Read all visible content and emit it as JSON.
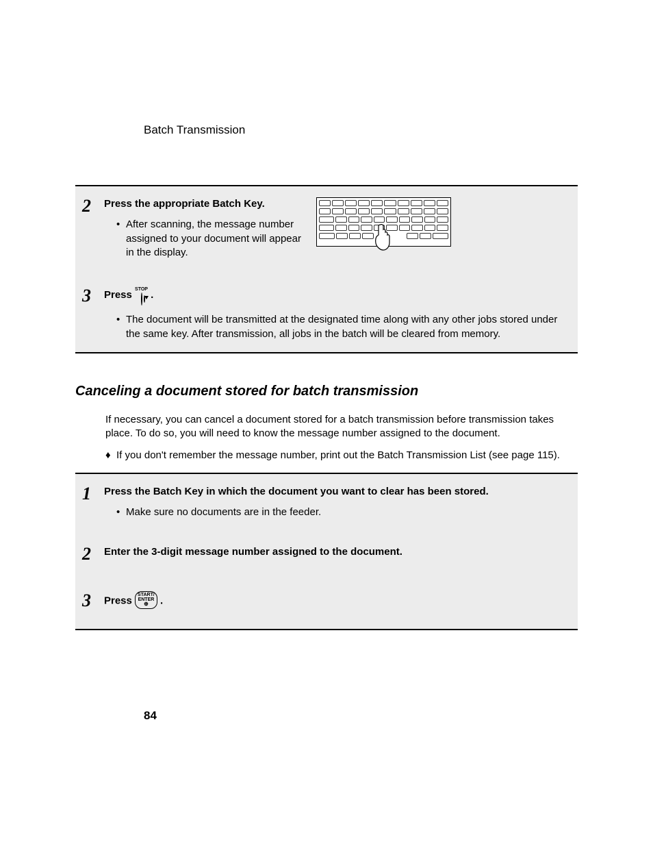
{
  "header": "Batch Transmission",
  "page_number": "84",
  "procA": {
    "steps": [
      {
        "num": "2",
        "title": "Press the appropriate Batch Key.",
        "bullets": [
          "After scanning, the message number assigned to your document will appear in the display."
        ]
      },
      {
        "num": "3",
        "title_pre": "Press ",
        "title_post": " .",
        "stop_label": "STOP",
        "bullets": [
          "The document will be transmitted at the designated time along with any other jobs stored under the same key. After transmission, all jobs in the batch will be cleared from memory."
        ]
      }
    ]
  },
  "subheading": "Canceling a document stored for batch transmission",
  "intro": "If necessary, you can cancel a document stored for a batch transmission before transmission takes place. To do so, you will need to know the message number assigned to the document.",
  "diamond_bullet": "If you don't remember the message number, print out the Batch Transmission List (see page 115).",
  "procB": {
    "steps": [
      {
        "num": "1",
        "title": "Press the Batch Key in which the document you want to clear has been stored.",
        "bullets": [
          "Make sure no documents are in the feeder."
        ]
      },
      {
        "num": "2",
        "title": "Enter the 3-digit message number assigned to the document."
      },
      {
        "num": "3",
        "title_pre": "Press ",
        "title_post": ".",
        "start_l1": "START/",
        "start_l2": "ENTER"
      }
    ]
  }
}
